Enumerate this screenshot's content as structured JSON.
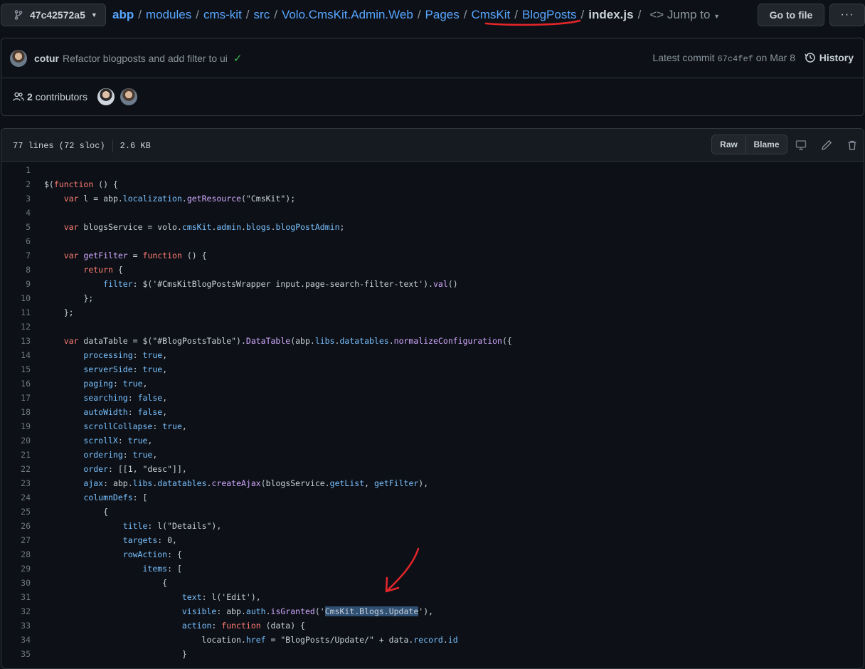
{
  "branch": {
    "name": "47c42572a5"
  },
  "breadcrumb": {
    "repo": "abp",
    "path": [
      "modules",
      "cms-kit",
      "src",
      "Volo.CmsKit.Admin.Web",
      "Pages",
      "CmsKit",
      "BlogPosts"
    ],
    "file": "index.js",
    "jump_to": "Jump to"
  },
  "header_buttons": {
    "go_to_file": "Go to file",
    "more": "···"
  },
  "commit": {
    "author": "cotur",
    "message": "Refactor blogposts and add filter to ui",
    "latest_label": "Latest commit",
    "sha": "67c4fef",
    "date": "on Mar 8",
    "history": "History"
  },
  "contributors": {
    "count": "2",
    "label": "contributors"
  },
  "file_info": {
    "lines": "77 lines (72 sloc)",
    "size": "2.6 KB",
    "raw": "Raw",
    "blame": "Blame"
  },
  "colors": {
    "bg": "#0d1117",
    "link": "#58a6ff",
    "keyword": "#ff7b72",
    "function": "#d2a8ff",
    "string": "#a5d6ff",
    "property": "#79c0ff",
    "annotation": "#e5252a"
  },
  "icons": [
    "branch-icon",
    "caret-down-icon",
    "code-icon",
    "kebab-icon",
    "check-icon",
    "history-icon",
    "people-icon",
    "desktop-icon",
    "pencil-icon",
    "trash-icon"
  ],
  "code_lines": [
    {
      "n": "1",
      "t": []
    },
    {
      "n": "2",
      "t": [
        [
          "$(",
          ""
        ],
        [
          "function",
          "k"
        ],
        [
          " () {",
          ""
        ]
      ]
    },
    {
      "n": "3",
      "t": [
        [
          "    ",
          ""
        ],
        [
          "var",
          "k"
        ],
        [
          " l = abp.",
          ""
        ],
        [
          "localization",
          "p"
        ],
        [
          ".",
          ""
        ],
        [
          "getResource",
          "f"
        ],
        [
          "(\"CmsKit\");",
          ""
        ]
      ]
    },
    {
      "n": "4",
      "t": []
    },
    {
      "n": "5",
      "t": [
        [
          "    ",
          ""
        ],
        [
          "var",
          "k"
        ],
        [
          " blogsService = volo.",
          ""
        ],
        [
          "cmsKit",
          "p"
        ],
        [
          ".",
          ""
        ],
        [
          "admin",
          "p"
        ],
        [
          ".",
          ""
        ],
        [
          "blogs",
          "p"
        ],
        [
          ".",
          ""
        ],
        [
          "blogPostAdmin",
          "p"
        ],
        [
          ";",
          ""
        ]
      ]
    },
    {
      "n": "6",
      "t": []
    },
    {
      "n": "7",
      "t": [
        [
          "    ",
          ""
        ],
        [
          "var",
          "k"
        ],
        [
          " ",
          ""
        ],
        [
          "getFilter",
          "f"
        ],
        [
          " = ",
          ""
        ],
        [
          "function",
          "k"
        ],
        [
          " () {",
          ""
        ]
      ]
    },
    {
      "n": "8",
      "t": [
        [
          "        ",
          ""
        ],
        [
          "return",
          "k"
        ],
        [
          " {",
          ""
        ]
      ]
    },
    {
      "n": "9",
      "t": [
        [
          "            ",
          ""
        ],
        [
          "filter",
          "p"
        ],
        [
          ": $('#CmsKitBlogPostsWrapper input.page-search-filter-text').",
          ""
        ],
        [
          "val",
          "f"
        ],
        [
          "()",
          ""
        ]
      ]
    },
    {
      "n": "10",
      "t": [
        [
          "        };",
          ""
        ]
      ]
    },
    {
      "n": "11",
      "t": [
        [
          "    };",
          ""
        ]
      ]
    },
    {
      "n": "12",
      "t": []
    },
    {
      "n": "13",
      "t": [
        [
          "    ",
          ""
        ],
        [
          "var",
          "k"
        ],
        [
          " dataTable = $(\"#BlogPostsTable\").",
          ""
        ],
        [
          "DataTable",
          "f"
        ],
        [
          "(abp.",
          ""
        ],
        [
          "libs",
          "p"
        ],
        [
          ".",
          ""
        ],
        [
          "datatables",
          "p"
        ],
        [
          ".",
          ""
        ],
        [
          "normalizeConfiguration",
          "f"
        ],
        [
          "({",
          ""
        ]
      ]
    },
    {
      "n": "14",
      "t": [
        [
          "        ",
          ""
        ],
        [
          "processing",
          "p"
        ],
        [
          ": ",
          ""
        ],
        [
          "true",
          "p"
        ],
        [
          ",",
          ""
        ]
      ]
    },
    {
      "n": "15",
      "t": [
        [
          "        ",
          ""
        ],
        [
          "serverSide",
          "p"
        ],
        [
          ": ",
          ""
        ],
        [
          "true",
          "p"
        ],
        [
          ",",
          ""
        ]
      ]
    },
    {
      "n": "16",
      "t": [
        [
          "        ",
          ""
        ],
        [
          "paging",
          "p"
        ],
        [
          ": ",
          ""
        ],
        [
          "true",
          "p"
        ],
        [
          ",",
          ""
        ]
      ]
    },
    {
      "n": "17",
      "t": [
        [
          "        ",
          ""
        ],
        [
          "searching",
          "p"
        ],
        [
          ": ",
          ""
        ],
        [
          "false",
          "p"
        ],
        [
          ",",
          ""
        ]
      ]
    },
    {
      "n": "18",
      "t": [
        [
          "        ",
          ""
        ],
        [
          "autoWidth",
          "p"
        ],
        [
          ": ",
          ""
        ],
        [
          "false",
          "p"
        ],
        [
          ",",
          ""
        ]
      ]
    },
    {
      "n": "19",
      "t": [
        [
          "        ",
          ""
        ],
        [
          "scrollCollapse",
          "p"
        ],
        [
          ": ",
          ""
        ],
        [
          "true",
          "p"
        ],
        [
          ",",
          ""
        ]
      ]
    },
    {
      "n": "20",
      "t": [
        [
          "        ",
          ""
        ],
        [
          "scrollX",
          "p"
        ],
        [
          ": ",
          ""
        ],
        [
          "true",
          "p"
        ],
        [
          ",",
          ""
        ]
      ]
    },
    {
      "n": "21",
      "t": [
        [
          "        ",
          ""
        ],
        [
          "ordering",
          "p"
        ],
        [
          ": ",
          ""
        ],
        [
          "true",
          "p"
        ],
        [
          ",",
          ""
        ]
      ]
    },
    {
      "n": "22",
      "t": [
        [
          "        ",
          ""
        ],
        [
          "order",
          "p"
        ],
        [
          ": [[1, \"desc\"]],",
          ""
        ]
      ]
    },
    {
      "n": "23",
      "t": [
        [
          "        ",
          ""
        ],
        [
          "ajax",
          "p"
        ],
        [
          ": abp.",
          ""
        ],
        [
          "libs",
          "p"
        ],
        [
          ".",
          ""
        ],
        [
          "datatables",
          "p"
        ],
        [
          ".",
          ""
        ],
        [
          "createAjax",
          "f"
        ],
        [
          "(blogsService.",
          ""
        ],
        [
          "getList",
          "p"
        ],
        [
          ", ",
          ""
        ],
        [
          "getFilter",
          "p"
        ],
        [
          "),",
          ""
        ]
      ]
    },
    {
      "n": "24",
      "t": [
        [
          "        ",
          ""
        ],
        [
          "columnDefs",
          "p"
        ],
        [
          ": [",
          ""
        ]
      ]
    },
    {
      "n": "25",
      "t": [
        [
          "            {",
          ""
        ]
      ]
    },
    {
      "n": "26",
      "t": [
        [
          "                ",
          ""
        ],
        [
          "title",
          "p"
        ],
        [
          ": l(\"Details\"),",
          ""
        ]
      ]
    },
    {
      "n": "27",
      "t": [
        [
          "                ",
          ""
        ],
        [
          "targets",
          "p"
        ],
        [
          ": 0,",
          ""
        ]
      ]
    },
    {
      "n": "28",
      "t": [
        [
          "                ",
          ""
        ],
        [
          "rowAction",
          "p"
        ],
        [
          ": {",
          ""
        ]
      ]
    },
    {
      "n": "29",
      "t": [
        [
          "                    ",
          ""
        ],
        [
          "items",
          "p"
        ],
        [
          ": [",
          ""
        ]
      ]
    },
    {
      "n": "30",
      "t": [
        [
          "                        {",
          ""
        ]
      ]
    },
    {
      "n": "31",
      "t": [
        [
          "                            ",
          ""
        ],
        [
          "text",
          "p"
        ],
        [
          ": l('Edit'),",
          ""
        ]
      ]
    },
    {
      "n": "32",
      "t": [
        [
          "                            ",
          ""
        ],
        [
          "visible",
          "p"
        ],
        [
          ": abp.",
          ""
        ],
        [
          "auth",
          "p"
        ],
        [
          ".",
          ""
        ],
        [
          "isGranted",
          "f"
        ],
        [
          "('",
          ""
        ],
        [
          "CmsKit.Blogs.Update",
          "hl"
        ],
        [
          "'),",
          ""
        ]
      ]
    },
    {
      "n": "33",
      "t": [
        [
          "                            ",
          ""
        ],
        [
          "action",
          "p"
        ],
        [
          ": ",
          ""
        ],
        [
          "function",
          "k"
        ],
        [
          " (data) {",
          ""
        ]
      ]
    },
    {
      "n": "34",
      "t": [
        [
          "                                location.",
          ""
        ],
        [
          "href",
          "p"
        ],
        [
          " = \"BlogPosts/Update/\" + data.",
          ""
        ],
        [
          "record",
          "p"
        ],
        [
          ".",
          ""
        ],
        [
          "id",
          "p"
        ]
      ]
    },
    {
      "n": "35",
      "t": [
        [
          "                            }",
          ""
        ]
      ]
    }
  ]
}
